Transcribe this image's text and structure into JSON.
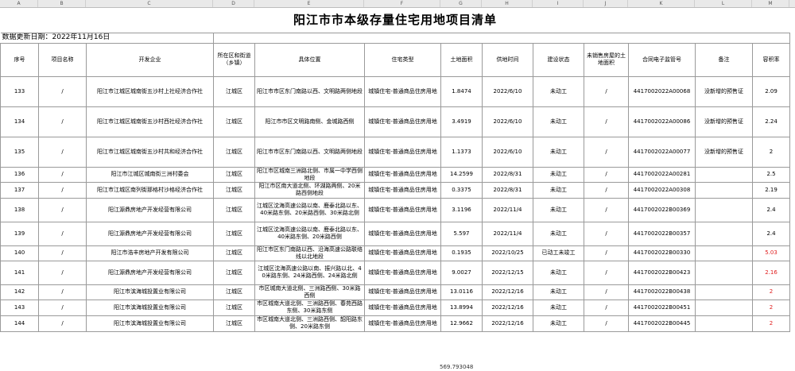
{
  "sheet": {
    "title": "阳江市市本级存量住宅用地项目清单",
    "update_label": "数据更新日期：2022年11月16日",
    "column_letters": [
      "A",
      "B",
      "C",
      "D",
      "E",
      "F",
      "G",
      "H",
      "I",
      "J",
      "K",
      "L",
      "M"
    ],
    "headers": [
      "序号",
      "项目名称",
      "开发企业",
      "所在区和街道（乡镇）",
      "具体位置",
      "住宅类型",
      "土地面积",
      "供地时间",
      "建设状态",
      "未销售房屋的土地面积",
      "合同电子监管号",
      "备注",
      "容积率"
    ],
    "rows": [
      {
        "no": "133",
        "name": "/",
        "dev": "阳江市江城区城南街五沙村上社经济合作社",
        "district": "江城区",
        "loc": "阳江市市区东门南路以西、文明路两侧地段",
        "type": "城镇住宅-普通商品住房用地",
        "area": "1.8474",
        "date": "2022/6/10",
        "status": "未动工",
        "unsold": "/",
        "contract": "4417002022A00068",
        "note": "没新增的预售证",
        "far": "2.09",
        "far_red": false
      },
      {
        "no": "134",
        "name": "/",
        "dev": "阳江市江城区城南街五沙村西社经济合作社",
        "district": "江城区",
        "loc": "阳江市市区文明路南侧、金城路西侧",
        "type": "城镇住宅-普通商品住房用地",
        "area": "3.4919",
        "date": "2022/6/10",
        "status": "未动工",
        "unsold": "/",
        "contract": "4417002022A00086",
        "note": "没新增的预售证",
        "far": "2.24",
        "far_red": false
      },
      {
        "no": "135",
        "name": "/",
        "dev": "阳江市江城区城南街五沙村共和经济合作社",
        "district": "江城区",
        "loc": "阳江市市区东门南路以西、文明路两侧地段",
        "type": "城镇住宅-普通商品住房用地",
        "area": "1.1373",
        "date": "2022/6/10",
        "status": "未动工",
        "unsold": "/",
        "contract": "4417002022A00077",
        "note": "没新增的预售证",
        "far": "2",
        "far_red": false
      },
      {
        "no": "136",
        "name": "/",
        "dev": "阳江市江城区城南街三洲村委会",
        "district": "江城区",
        "loc": "阳江市区城南三洲路北侧、市属一中学西侧地段",
        "type": "城镇住宅-普通商品住房用地",
        "area": "14.2599",
        "date": "2022/8/31",
        "status": "未动工",
        "unsold": "/",
        "contract": "4417002022A00281",
        "note": "",
        "far": "2.5",
        "far_red": false
      },
      {
        "no": "137",
        "name": "/",
        "dev": "阳江市江城区南列街那格村沙格经济合作社",
        "district": "江城区",
        "loc": "阳江市区南大道北侧、环湖路两侧、20米路西侧地段",
        "type": "城镇住宅-普通商品住房用地",
        "area": "0.3375",
        "date": "2022/8/31",
        "status": "未动工",
        "unsold": "/",
        "contract": "4417002022A00308",
        "note": "",
        "far": "2.19",
        "far_red": false
      },
      {
        "no": "138",
        "name": "/",
        "dev": "阳江源鼎房地产开发经营有限公司",
        "district": "江城区",
        "loc": "江城区沈海高速公路以南、鹿泰北路以东、40米路东侧、20米路西侧、30米路北侧",
        "type": "城镇住宅-普通商品住房用地",
        "area": "3.1196",
        "date": "2022/11/4",
        "status": "未动工",
        "unsold": "/",
        "contract": "4417002022B00369",
        "note": "",
        "far": "2.4",
        "far_red": false
      },
      {
        "no": "139",
        "name": "/",
        "dev": "阳江源鼎房地产开发经营有限公司",
        "district": "江城区",
        "loc": "江城区沈海高速公路以南、鹿泰北路以东、40米路东侧、20米路西侧",
        "type": "城镇住宅-普通商品住房用地",
        "area": "5.597",
        "date": "2022/11/4",
        "status": "未动工",
        "unsold": "/",
        "contract": "4417002022B00357",
        "note": "",
        "far": "2.4",
        "far_red": false
      },
      {
        "no": "140",
        "name": "/",
        "dev": "阳江市浩丰房地产开发有限公司",
        "district": "江城区",
        "loc": "阳江市区东门南路以西、沿海高速公路联络线以北地段",
        "type": "城镇住宅-普通商品住房用地",
        "area": "0.1935",
        "date": "2022/10/25",
        "status": "已动工未竣工",
        "unsold": "/",
        "contract": "4417002022B00330",
        "note": "",
        "far": "5.03",
        "far_red": true
      },
      {
        "no": "141",
        "name": "/",
        "dev": "阳江源鼎房地产开发经营有限公司",
        "district": "江城区",
        "loc": "江城区沈海高速公路以南、振兴路以北、40米路东侧、24米路西侧、24米路北侧",
        "type": "城镇住宅-普通商品住房用地",
        "area": "9.0027",
        "date": "2022/12/15",
        "status": "未动工",
        "unsold": "/",
        "contract": "4417002022B00423",
        "note": "",
        "far": "2.16",
        "far_red": true
      },
      {
        "no": "142",
        "name": "/",
        "dev": "阳江市滨海城投置业有限公司",
        "district": "江城区",
        "loc": "市区城南大道北侧、三洲路西侧、30米路西侧",
        "type": "城镇住宅-普通商品住房用地",
        "area": "13.0116",
        "date": "2022/12/16",
        "status": "未动工",
        "unsold": "/",
        "contract": "4417002022B00438",
        "note": "",
        "far": "2",
        "far_red": true
      },
      {
        "no": "143",
        "name": "/",
        "dev": "阳江市滨海城投置业有限公司",
        "district": "江城区",
        "loc": "市区城南大道北侧、三洲路西侧、春苑西路东侧、30米路东侧",
        "type": "城镇住宅-普通商品住房用地",
        "area": "13.8994",
        "date": "2022/12/16",
        "status": "未动工",
        "unsold": "/",
        "contract": "4417002022B00451",
        "note": "",
        "far": "2",
        "far_red": true
      },
      {
        "no": "144",
        "name": "/",
        "dev": "阳江市滨海城投置业有限公司",
        "district": "江城区",
        "loc": "市区城南大道北侧、三洲路西侧、韶阳路东侧、20米路东侧",
        "type": "城镇住宅-普通商品住房用地",
        "area": "12.9662",
        "date": "2022/12/16",
        "status": "未动工",
        "unsold": "/",
        "contract": "4417002022B00445",
        "note": "",
        "far": "2",
        "far_red": true
      }
    ],
    "footer_total": "569.793048"
  }
}
